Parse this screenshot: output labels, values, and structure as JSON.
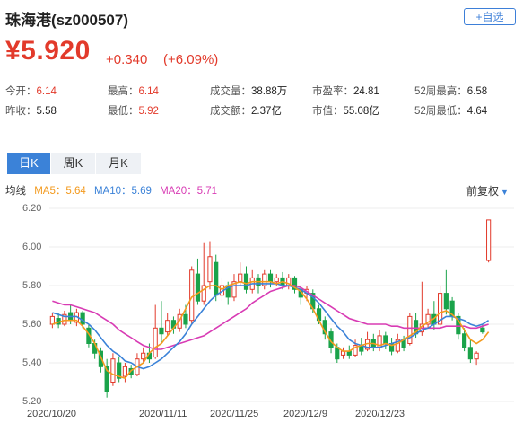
{
  "header": {
    "title": "珠海港(sz000507)",
    "watch_label": "+自选"
  },
  "quote": {
    "price": "¥5.920",
    "change": "+0.340",
    "change_pct": "(+6.09%)"
  },
  "stats": [
    {
      "label": "今开：",
      "value": "6.14",
      "red": true
    },
    {
      "label": "最高：",
      "value": "6.14",
      "red": true
    },
    {
      "label": "成交量：",
      "value": "38.88万",
      "red": false
    },
    {
      "label": "市盈率：",
      "value": "24.81",
      "red": false
    },
    {
      "label": "52周最高：",
      "value": "6.58",
      "red": false
    },
    {
      "label": "昨收：",
      "value": "5.58",
      "red": false
    },
    {
      "label": "最低：",
      "value": "5.92",
      "red": true
    },
    {
      "label": "成交额：",
      "value": "2.37亿",
      "red": false
    },
    {
      "label": "市值：",
      "value": "55.08亿",
      "red": false
    },
    {
      "label": "52周最低：",
      "value": "4.64",
      "red": false
    }
  ],
  "tabs": [
    "日K",
    "周K",
    "月K"
  ],
  "active_tab": "日K",
  "ma": {
    "label": "均线",
    "ma5": "MA5：5.64",
    "ma10": "MA10：5.69",
    "ma20": "MA20：5.71"
  },
  "adjust_label": "前复权",
  "colors": {
    "up": "#e23a2b",
    "down": "#1aa34a",
    "ma5": "#f39a1e",
    "ma10": "#3b82d8",
    "ma20": "#d83bb4",
    "accent": "#3b82d8"
  },
  "chart_data": {
    "type": "candlestick",
    "ylim": [
      5.2,
      6.2
    ],
    "yticks": [
      "6.20",
      "6.00",
      "5.80",
      "5.60",
      "5.40",
      "5.20"
    ],
    "x_tick_labels": [
      "2020/10/20",
      "2020/11/11",
      "2020/11/25",
      "2020/12/9",
      "2020/12/23"
    ],
    "candles": [
      {
        "o": 5.6,
        "c": 5.64,
        "h": 5.66,
        "l": 5.58
      },
      {
        "o": 5.63,
        "c": 5.6,
        "h": 5.66,
        "l": 5.58
      },
      {
        "o": 5.6,
        "c": 5.65,
        "h": 5.67,
        "l": 5.59
      },
      {
        "o": 5.66,
        "c": 5.62,
        "h": 5.7,
        "l": 5.6
      },
      {
        "o": 5.61,
        "c": 5.66,
        "h": 5.68,
        "l": 5.59
      },
      {
        "o": 5.66,
        "c": 5.6,
        "h": 5.67,
        "l": 5.58
      },
      {
        "o": 5.58,
        "c": 5.5,
        "h": 5.6,
        "l": 5.48
      },
      {
        "o": 5.5,
        "c": 5.45,
        "h": 5.52,
        "l": 5.42
      },
      {
        "o": 5.46,
        "c": 5.38,
        "h": 5.48,
        "l": 5.35
      },
      {
        "o": 5.38,
        "c": 5.25,
        "h": 5.42,
        "l": 5.22
      },
      {
        "o": 5.3,
        "c": 5.42,
        "h": 5.45,
        "l": 5.28
      },
      {
        "o": 5.4,
        "c": 5.32,
        "h": 5.43,
        "l": 5.3
      },
      {
        "o": 5.33,
        "c": 5.38,
        "h": 5.4,
        "l": 5.3
      },
      {
        "o": 5.37,
        "c": 5.34,
        "h": 5.39,
        "l": 5.32
      },
      {
        "o": 5.34,
        "c": 5.42,
        "h": 5.45,
        "l": 5.33
      },
      {
        "o": 5.42,
        "c": 5.45,
        "h": 5.48,
        "l": 5.4
      },
      {
        "o": 5.45,
        "c": 5.42,
        "h": 5.5,
        "l": 5.4
      },
      {
        "o": 5.43,
        "c": 5.58,
        "h": 5.7,
        "l": 5.42
      },
      {
        "o": 5.58,
        "c": 5.55,
        "h": 5.72,
        "l": 5.5
      },
      {
        "o": 5.56,
        "c": 5.62,
        "h": 5.66,
        "l": 5.54
      },
      {
        "o": 5.62,
        "c": 5.58,
        "h": 5.64,
        "l": 5.55
      },
      {
        "o": 5.58,
        "c": 5.65,
        "h": 5.68,
        "l": 5.56
      },
      {
        "o": 5.65,
        "c": 5.6,
        "h": 5.7,
        "l": 5.58
      },
      {
        "o": 5.62,
        "c": 5.88,
        "h": 5.9,
        "l": 5.6
      },
      {
        "o": 5.86,
        "c": 5.72,
        "h": 5.94,
        "l": 5.7
      },
      {
        "o": 5.72,
        "c": 5.8,
        "h": 6.02,
        "l": 5.7
      },
      {
        "o": 5.82,
        "c": 5.95,
        "h": 6.03,
        "l": 5.78
      },
      {
        "o": 5.92,
        "c": 5.75,
        "h": 5.96,
        "l": 5.72
      },
      {
        "o": 5.75,
        "c": 5.8,
        "h": 5.84,
        "l": 5.72
      },
      {
        "o": 5.8,
        "c": 5.74,
        "h": 5.82,
        "l": 5.7
      },
      {
        "o": 5.74,
        "c": 5.82,
        "h": 5.86,
        "l": 5.72
      },
      {
        "o": 5.82,
        "c": 5.86,
        "h": 5.92,
        "l": 5.8
      },
      {
        "o": 5.86,
        "c": 5.78,
        "h": 5.9,
        "l": 5.76
      },
      {
        "o": 5.78,
        "c": 5.84,
        "h": 5.88,
        "l": 5.76
      },
      {
        "o": 5.84,
        "c": 5.8,
        "h": 5.86,
        "l": 5.76
      },
      {
        "o": 5.8,
        "c": 5.86,
        "h": 5.88,
        "l": 5.78
      },
      {
        "o": 5.86,
        "c": 5.82,
        "h": 5.88,
        "l": 5.79
      },
      {
        "o": 5.82,
        "c": 5.84,
        "h": 5.86,
        "l": 5.8
      },
      {
        "o": 5.84,
        "c": 5.8,
        "h": 5.87,
        "l": 5.78
      },
      {
        "o": 5.8,
        "c": 5.84,
        "h": 5.86,
        "l": 5.78
      },
      {
        "o": 5.84,
        "c": 5.78,
        "h": 5.85,
        "l": 5.76
      },
      {
        "o": 5.78,
        "c": 5.74,
        "h": 5.8,
        "l": 5.7
      },
      {
        "o": 5.76,
        "c": 5.78,
        "h": 5.8,
        "l": 5.72
      },
      {
        "o": 5.76,
        "c": 5.68,
        "h": 5.78,
        "l": 5.66
      },
      {
        "o": 5.68,
        "c": 5.62,
        "h": 5.7,
        "l": 5.6
      },
      {
        "o": 5.62,
        "c": 5.55,
        "h": 5.64,
        "l": 5.52
      },
      {
        "o": 5.56,
        "c": 5.48,
        "h": 5.58,
        "l": 5.45
      },
      {
        "o": 5.48,
        "c": 5.42,
        "h": 5.5,
        "l": 5.4
      },
      {
        "o": 5.44,
        "c": 5.46,
        "h": 5.48,
        "l": 5.42
      },
      {
        "o": 5.46,
        "c": 5.44,
        "h": 5.49,
        "l": 5.42
      },
      {
        "o": 5.44,
        "c": 5.49,
        "h": 5.52,
        "l": 5.43
      },
      {
        "o": 5.49,
        "c": 5.46,
        "h": 5.53,
        "l": 5.44
      },
      {
        "o": 5.47,
        "c": 5.52,
        "h": 5.56,
        "l": 5.46
      },
      {
        "o": 5.52,
        "c": 5.48,
        "h": 5.55,
        "l": 5.46
      },
      {
        "o": 5.48,
        "c": 5.54,
        "h": 5.57,
        "l": 5.46
      },
      {
        "o": 5.54,
        "c": 5.5,
        "h": 5.56,
        "l": 5.47
      },
      {
        "o": 5.5,
        "c": 5.46,
        "h": 5.53,
        "l": 5.44
      },
      {
        "o": 5.46,
        "c": 5.52,
        "h": 5.55,
        "l": 5.45
      },
      {
        "o": 5.52,
        "c": 5.48,
        "h": 5.54,
        "l": 5.46
      },
      {
        "o": 5.5,
        "c": 5.64,
        "h": 5.66,
        "l": 5.49
      },
      {
        "o": 5.62,
        "c": 5.55,
        "h": 5.66,
        "l": 5.53
      },
      {
        "o": 5.56,
        "c": 5.6,
        "h": 5.82,
        "l": 5.54
      },
      {
        "o": 5.6,
        "c": 5.65,
        "h": 5.68,
        "l": 5.58
      },
      {
        "o": 5.65,
        "c": 5.6,
        "h": 5.72,
        "l": 5.57
      },
      {
        "o": 5.6,
        "c": 5.76,
        "h": 5.8,
        "l": 5.58
      },
      {
        "o": 5.76,
        "c": 5.68,
        "h": 5.88,
        "l": 5.65
      },
      {
        "o": 5.72,
        "c": 5.64,
        "h": 5.74,
        "l": 5.62
      },
      {
        "o": 5.64,
        "c": 5.55,
        "h": 5.66,
        "l": 5.52
      },
      {
        "o": 5.55,
        "c": 5.48,
        "h": 5.58,
        "l": 5.46
      },
      {
        "o": 5.48,
        "c": 5.42,
        "h": 5.52,
        "l": 5.4
      },
      {
        "o": 5.42,
        "c": 5.45,
        "h": 5.46,
        "l": 5.39
      },
      {
        "o": 5.58,
        "c": 5.56,
        "h": 5.6,
        "l": 5.55
      },
      {
        "o": 5.93,
        "c": 6.14,
        "h": 6.14,
        "l": 5.92
      }
    ],
    "ma5": [
      5.6,
      5.61,
      5.62,
      5.62,
      5.62,
      5.59,
      5.55,
      5.5,
      5.43,
      5.36,
      5.34,
      5.33,
      5.32,
      5.36,
      5.38,
      5.4,
      5.45,
      5.48,
      5.5,
      5.54,
      5.58,
      5.62,
      5.68,
      5.74,
      5.76,
      5.78,
      5.8,
      5.8,
      5.78,
      5.8,
      5.81,
      5.82,
      5.81,
      5.82,
      5.82,
      5.82,
      5.82,
      5.81,
      5.82,
      5.81,
      5.79,
      5.77,
      5.73,
      5.68,
      5.62,
      5.56,
      5.51,
      5.48,
      5.46,
      5.46,
      5.48,
      5.49,
      5.5,
      5.5,
      5.49,
      5.5,
      5.49,
      5.5,
      5.52,
      5.54,
      5.56,
      5.59,
      5.61,
      5.63,
      5.66,
      5.67,
      5.65,
      5.62,
      5.57,
      5.52,
      5.5,
      5.52,
      5.56
    ],
    "ma10": [
      5.66,
      5.65,
      5.64,
      5.64,
      5.64,
      5.62,
      5.6,
      5.57,
      5.53,
      5.49,
      5.46,
      5.44,
      5.41,
      5.4,
      5.38,
      5.37,
      5.38,
      5.4,
      5.42,
      5.45,
      5.48,
      5.51,
      5.55,
      5.6,
      5.64,
      5.68,
      5.72,
      5.75,
      5.77,
      5.79,
      5.8,
      5.8,
      5.8,
      5.81,
      5.81,
      5.81,
      5.81,
      5.81,
      5.8,
      5.8,
      5.79,
      5.78,
      5.76,
      5.74,
      5.71,
      5.67,
      5.63,
      5.59,
      5.56,
      5.52,
      5.5,
      5.49,
      5.48,
      5.48,
      5.48,
      5.49,
      5.5,
      5.51,
      5.52,
      5.53,
      5.55,
      5.57,
      5.58,
      5.6,
      5.62,
      5.64,
      5.64,
      5.63,
      5.62,
      5.6,
      5.59,
      5.6,
      5.62
    ],
    "ma20": [
      5.72,
      5.71,
      5.7,
      5.7,
      5.69,
      5.68,
      5.67,
      5.66,
      5.64,
      5.62,
      5.6,
      5.57,
      5.55,
      5.53,
      5.51,
      5.49,
      5.48,
      5.47,
      5.47,
      5.48,
      5.49,
      5.5,
      5.51,
      5.52,
      5.53,
      5.54,
      5.56,
      5.58,
      5.6,
      5.62,
      5.64,
      5.66,
      5.68,
      5.71,
      5.73,
      5.75,
      5.77,
      5.78,
      5.79,
      5.8,
      5.8,
      5.79,
      5.77,
      5.75,
      5.73,
      5.71,
      5.69,
      5.67,
      5.65,
      5.63,
      5.62,
      5.61,
      5.6,
      5.6,
      5.6,
      5.6,
      5.59,
      5.59,
      5.58,
      5.58,
      5.58,
      5.58,
      5.58,
      5.58,
      5.58,
      5.59,
      5.59,
      5.59,
      5.59,
      5.58,
      5.58,
      5.59,
      5.6
    ]
  }
}
